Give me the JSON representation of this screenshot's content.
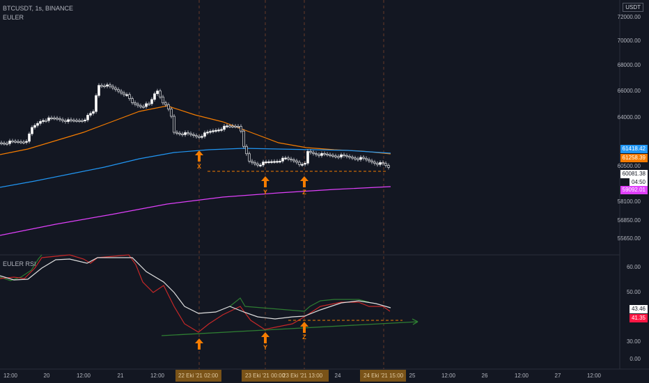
{
  "header": {
    "symbol": "BTCUSDT, 1s, BINANCE",
    "indicator": "EULER"
  },
  "rsi_panel": {
    "title": "EULER RSI"
  },
  "currency": "USDT",
  "price_axis": {
    "ticks": [
      "72000.00",
      "70000.00",
      "68000.00",
      "66000.00",
      "64000.00",
      "60500.00",
      "58100.00",
      "56850.00",
      "55650.00"
    ],
    "current_price": "60081.38",
    "countdown": "04:50",
    "badges": [
      {
        "value": "61418.42",
        "color": "#2196f3"
      },
      {
        "value": "61258.39",
        "color": "#f57c00"
      },
      {
        "value": "59092.01",
        "color": "#e040fb"
      }
    ]
  },
  "rsi_axis": {
    "ticks": [
      "60.00",
      "50.00",
      "30.00",
      "0.00"
    ],
    "badges": [
      {
        "value": "43.46",
        "color": "#ffffff"
      },
      {
        "value": "41.35",
        "color": "#ff1744"
      }
    ]
  },
  "time_axis": {
    "ticks": [
      "12:00",
      "20",
      "12:00",
      "21",
      "12:00",
      "24",
      "25",
      "12:00",
      "26",
      "12:00",
      "27",
      "12:00"
    ],
    "highlights": [
      "22 Eki '21  02:00",
      "23 Eki '21  00:00",
      "23 Eki '21  13:00",
      "24 Eki '21  15:00"
    ]
  },
  "annotations": {
    "points": [
      "X",
      "Y",
      "Z"
    ]
  },
  "colors": {
    "background": "#131722",
    "ema_orange": "#f57c00",
    "ema_blue": "#2196f3",
    "ema_magenta": "#e040fb",
    "rsi_white": "#e0e0e0",
    "rsi_red": "#c62828",
    "rsi_green": "#2e7d32",
    "annotation": "#f57c00"
  }
}
